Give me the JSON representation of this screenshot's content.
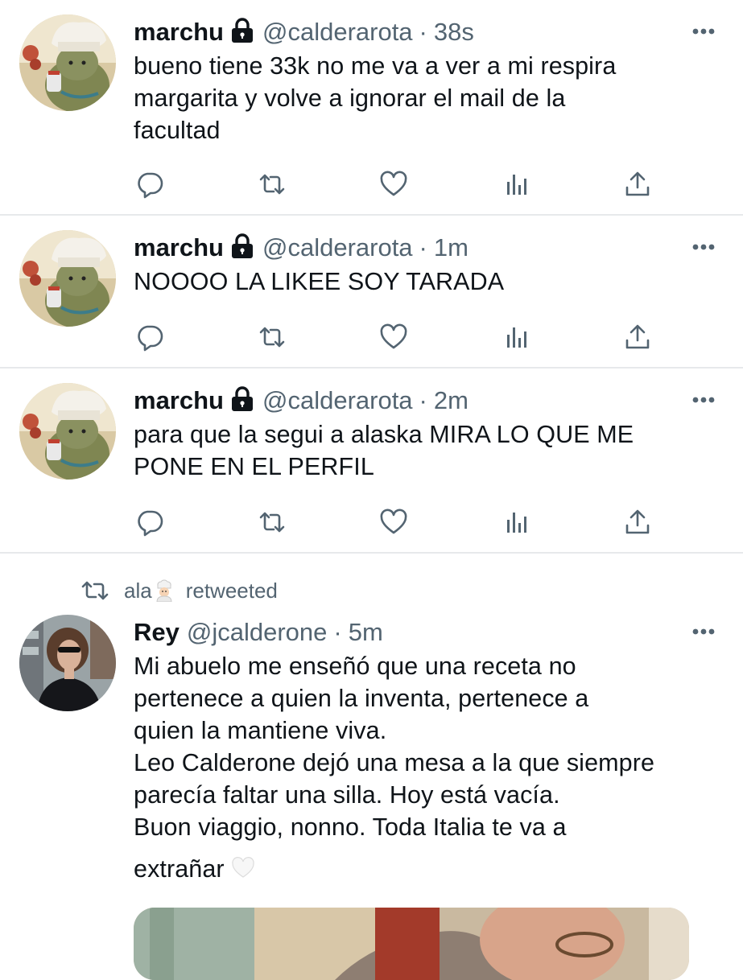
{
  "tweets": [
    {
      "name": "marchu",
      "handle": "@calderarota",
      "separator": "·",
      "time": "38s",
      "lines": [
        "bueno tiene 33k no me va a ver a mi respira",
        "margarita y volve a ignorar el mail de la",
        "facultad"
      ]
    },
    {
      "name": "marchu",
      "handle": "@calderarota",
      "separator": "·",
      "time": "1m",
      "lines": [
        "NOOOO LA LIKEE SOY TARADA"
      ]
    },
    {
      "name": "marchu",
      "handle": "@calderarota",
      "separator": "·",
      "time": "2m",
      "lines": [
        "para que la segui a alaska MIRA LO QUE ME",
        "PONE EN EL PERFIL"
      ]
    }
  ],
  "retweet": {
    "retweeter": "ala",
    "retweeter_emoji": "chef-emoji",
    "label": "retweeted",
    "tweet": {
      "name": "Rey",
      "handle": "@jcalderone",
      "separator": "·",
      "time": "5m",
      "lines": [
        "Mi abuelo me enseñó que una receta no",
        "pertenece a quien la inventa, pertenece a",
        "quien la mantiene viva.",
        "Leo Calderone dejó una mesa a la que siempre",
        "parecía faltar una silla. Hoy está vacía.",
        "Buon viaggio, nonno. Toda Italia te va a",
        "extrañar"
      ],
      "trailing_emoji": "white-heart-emoji"
    }
  },
  "icons": {
    "actions": [
      "reply-icon",
      "retweet-icon",
      "like-icon",
      "analytics-icon",
      "share-icon"
    ],
    "protected": "lock-icon",
    "more": "more-icon"
  },
  "colors": {
    "text": "#0f1419",
    "secondary": "#536471",
    "icon": "#536471",
    "divider": "#e7e9eb"
  }
}
